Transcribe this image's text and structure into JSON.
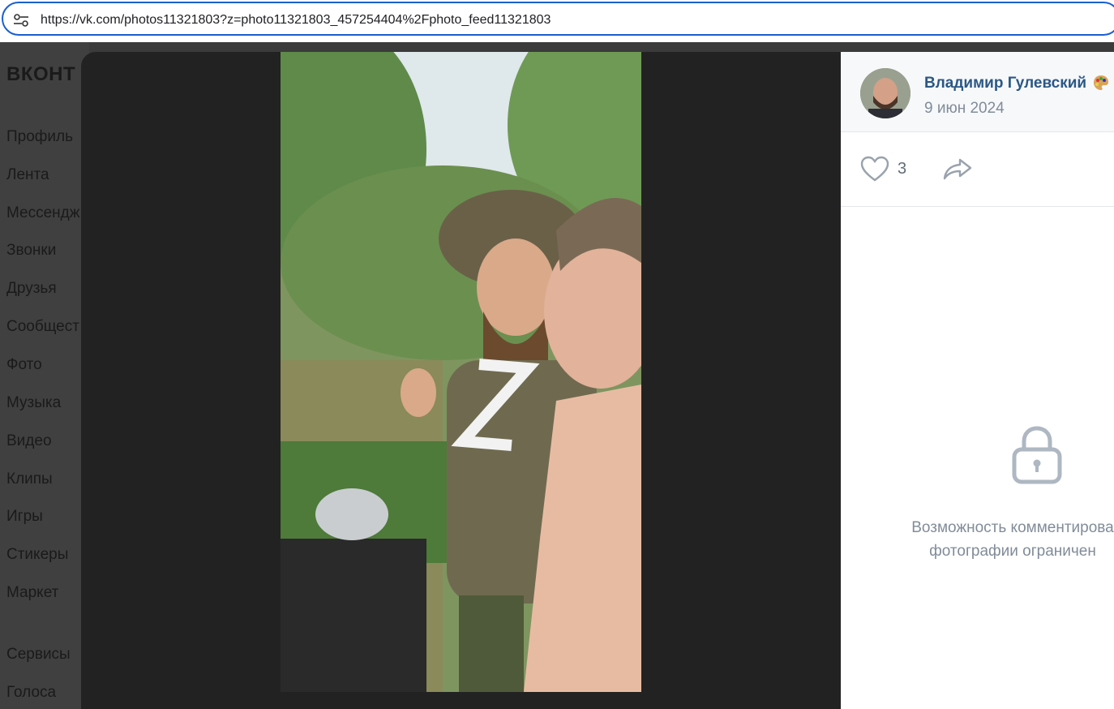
{
  "browser": {
    "url": "https://vk.com/photos11321803?z=photo11321803_457254404%2Fphoto_feed11321803",
    "site_settings_icon": "tune-icon"
  },
  "sidebar": {
    "logo": "ВКОНТ",
    "items": [
      {
        "label": "Профиль"
      },
      {
        "label": "Лента"
      },
      {
        "label": "Мессендж"
      },
      {
        "label": "Звонки"
      },
      {
        "label": "Друзья"
      },
      {
        "label": "Сообщест"
      },
      {
        "label": "Фото"
      },
      {
        "label": "Музыка"
      },
      {
        "label": "Видео"
      },
      {
        "label": "Клипы"
      },
      {
        "label": "Игры"
      },
      {
        "label": "Стикеры"
      },
      {
        "label": "Маркет"
      },
      {
        "label": "Сервисы"
      },
      {
        "label": "Голоса"
      }
    ]
  },
  "viewer": {
    "photo_alt": "photo",
    "author": {
      "name": "Владимир Гулевский",
      "badge_icon": "palette-icon",
      "date": "9 июн 2024"
    },
    "likes": {
      "icon": "heart-icon",
      "count": "3"
    },
    "share_icon": "share-icon",
    "comments": {
      "icon": "lock-icon",
      "line1": "Возможность комментирова",
      "line2": "фотографии ограничен"
    }
  },
  "colors": {
    "accent_border": "#1a5fd0",
    "author_link": "#2a5885",
    "muted_text": "#818c99"
  }
}
